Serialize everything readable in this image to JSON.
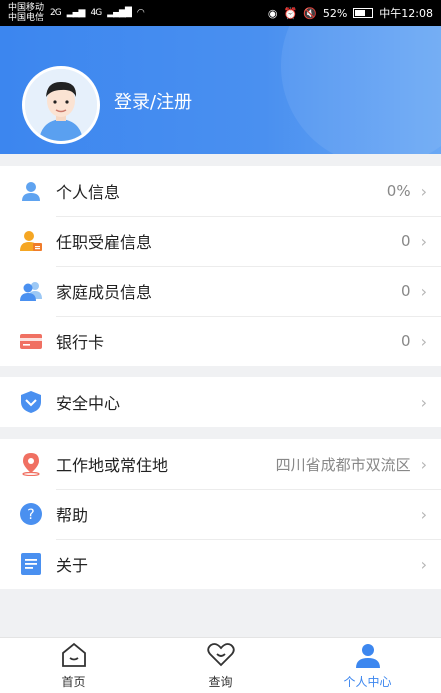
{
  "status": {
    "carrier1": "中国移动",
    "carrier2": "中国电信",
    "net1": "2G",
    "net2": "4G",
    "battery": "52%",
    "time": "中午12:08"
  },
  "header": {
    "login_label": "登录/注册"
  },
  "menu": {
    "group1": [
      {
        "label": "个人信息",
        "value": "0%"
      },
      {
        "label": "任职受雇信息",
        "value": "0"
      },
      {
        "label": "家庭成员信息",
        "value": "0"
      },
      {
        "label": "银行卡",
        "value": "0"
      }
    ],
    "group2": [
      {
        "label": "安全中心"
      }
    ],
    "group3": [
      {
        "label": "工作地或常住地",
        "value": "四川省成都市双流区"
      },
      {
        "label": "帮助"
      },
      {
        "label": "关于"
      }
    ]
  },
  "tabs": [
    {
      "label": "首页",
      "icon": "home-icon"
    },
    {
      "label": "查询",
      "icon": "heart-icon"
    },
    {
      "label": "个人中心",
      "icon": "person-icon"
    }
  ],
  "colors": {
    "accent": "#3d87ef",
    "header": "#4a90f0"
  }
}
